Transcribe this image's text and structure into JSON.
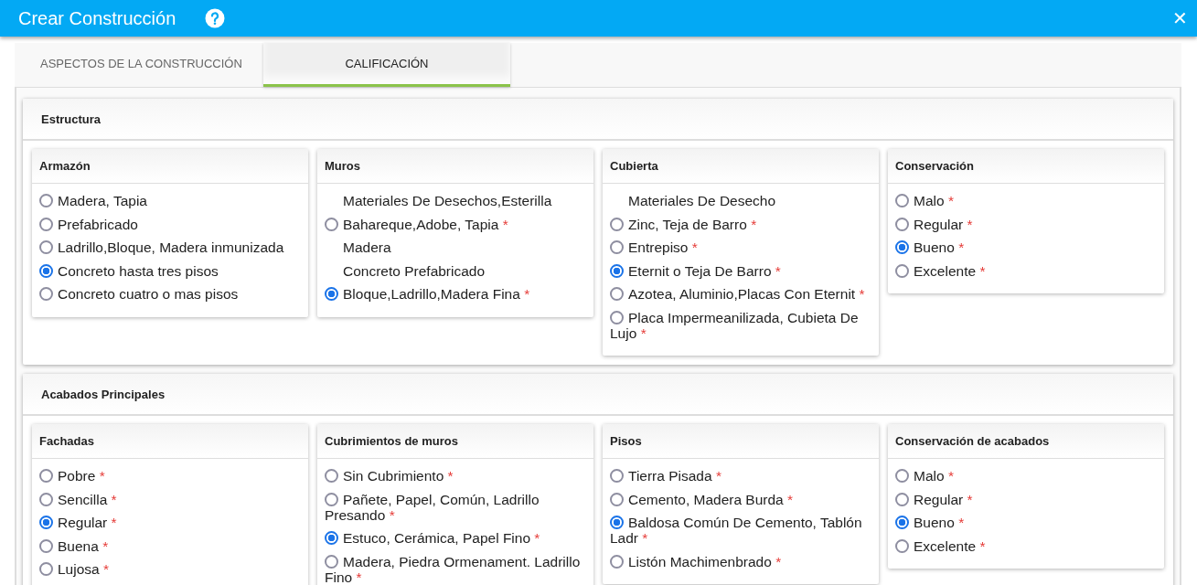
{
  "window": {
    "title": "Crear Construcción",
    "close": "✕"
  },
  "tabs": [
    {
      "label": "ASPECTOS DE LA CONSTRUCCIÓN",
      "selected": false
    },
    {
      "label": "CALIFICACIÓN",
      "selected": true
    }
  ],
  "sections": [
    {
      "title": "Estructura",
      "groups": [
        {
          "title": "Armazón",
          "options": [
            {
              "kind": "radio",
              "label": "Madera, Tapia",
              "selected": false
            },
            {
              "kind": "radio",
              "label": "Prefabricado",
              "selected": false
            },
            {
              "kind": "radio",
              "label": "Ladrillo,Bloque, Madera inmunizada",
              "selected": false
            },
            {
              "kind": "radio",
              "label": "Concreto hasta tres pisos",
              "selected": true
            },
            {
              "kind": "radio",
              "label": "Concreto cuatro o mas pisos",
              "selected": false
            }
          ]
        },
        {
          "title": "Muros",
          "options": [
            {
              "kind": "plain",
              "label": "Materiales De Desechos,Esterilla"
            },
            {
              "kind": "radio",
              "label": "Bahareque,Adobe, Tapia",
              "mark": "*",
              "selected": false
            },
            {
              "kind": "plain",
              "label": "Madera"
            },
            {
              "kind": "plain",
              "label": "Concreto Prefabricado"
            },
            {
              "kind": "radio",
              "label": "Bloque,Ladrillo,Madera Fina",
              "mark": "*",
              "selected": true
            }
          ]
        },
        {
          "title": "Cubierta",
          "options": [
            {
              "kind": "plain",
              "label": "Materiales De Desecho"
            },
            {
              "kind": "radio",
              "label": "Zinc, Teja de Barro",
              "mark": "*",
              "selected": false
            },
            {
              "kind": "radio",
              "label": "Entrepiso",
              "mark": "*",
              "selected": false
            },
            {
              "kind": "radio",
              "label": "Eternit o Teja De Barro",
              "mark": "*",
              "selected": true
            },
            {
              "kind": "radio",
              "label": "Azotea, Aluminio,Placas Con Eternit",
              "mark": "*",
              "selected": false
            },
            {
              "kind": "radio",
              "label": "Placa Impermeanilizada, Cubieta De Lujo",
              "mark": "*",
              "selected": false
            }
          ]
        },
        {
          "title": "Conservación",
          "options": [
            {
              "kind": "radio",
              "label": "Malo",
              "mark": "*",
              "selected": false
            },
            {
              "kind": "radio",
              "label": "Regular",
              "mark": "*",
              "selected": false
            },
            {
              "kind": "radio",
              "label": "Bueno",
              "mark": "*",
              "selected": true
            },
            {
              "kind": "radio",
              "label": "Excelente",
              "mark": "*",
              "selected": false
            }
          ]
        }
      ]
    },
    {
      "title": "Acabados Principales",
      "groups": [
        {
          "title": "Fachadas",
          "options": [
            {
              "kind": "radio",
              "label": "Pobre",
              "mark": "*",
              "selected": false
            },
            {
              "kind": "radio",
              "label": "Sencilla",
              "mark": "*",
              "selected": false
            },
            {
              "kind": "radio",
              "label": "Regular",
              "mark": "*",
              "selected": true
            },
            {
              "kind": "radio",
              "label": "Buena",
              "mark": "*",
              "selected": false
            },
            {
              "kind": "radio",
              "label": "Lujosa",
              "mark": "*",
              "selected": false
            }
          ]
        },
        {
          "title": "Cubrimientos de muros",
          "options": [
            {
              "kind": "radio",
              "label": "Sin Cubrimiento",
              "mark": "*",
              "selected": false
            },
            {
              "kind": "radio",
              "label": "Pañete, Papel, Común, Ladrillo Presando",
              "mark": "*",
              "selected": false
            },
            {
              "kind": "radio",
              "label": "Estuco, Cerámica, Papel Fino",
              "mark": "*",
              "selected": true
            },
            {
              "kind": "radio",
              "label": "Madera, Piedra Ormenament. Ladrillo Fino",
              "mark": "*",
              "selected": false
            }
          ]
        },
        {
          "title": "Pisos",
          "options": [
            {
              "kind": "radio",
              "label": "Tierra Pisada",
              "mark": "*",
              "selected": false
            },
            {
              "kind": "radio",
              "label": "Cemento, Madera Burda",
              "mark": "*",
              "selected": false
            },
            {
              "kind": "radio",
              "label": "Baldosa Común De Cemento, Tablón Ladr",
              "mark": "*",
              "selected": true
            },
            {
              "kind": "radio",
              "label": "Listón Machimenbrado",
              "mark": "*",
              "selected": false
            }
          ]
        },
        {
          "title": "Conservación de acabados",
          "options": [
            {
              "kind": "radio",
              "label": "Malo",
              "mark": "*",
              "selected": false
            },
            {
              "kind": "radio",
              "label": "Regular",
              "mark": "*",
              "selected": false
            },
            {
              "kind": "radio",
              "label": "Bueno",
              "mark": "*",
              "selected": true
            },
            {
              "kind": "radio",
              "label": "Excelente",
              "mark": "*",
              "selected": false
            }
          ]
        }
      ]
    }
  ]
}
